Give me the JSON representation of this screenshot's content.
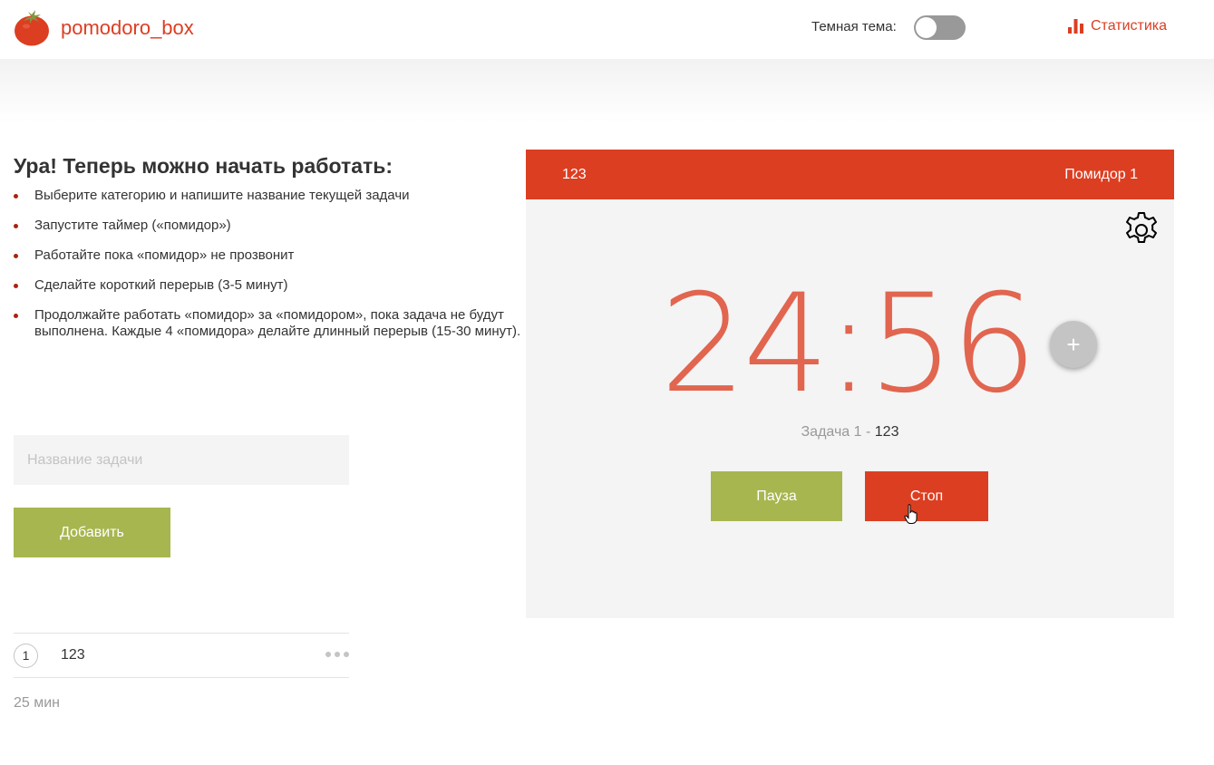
{
  "header": {
    "brand": "pomodoro_box",
    "theme_label": "Темная тема:",
    "dark_theme_enabled": false,
    "stats_label": "Статистика",
    "logo_icon": "tomato-logo-icon",
    "stats_icon": "bar-chart-icon"
  },
  "intro": {
    "title": "Ура! Теперь можно начать работать:",
    "steps": [
      "Выберите категорию и напишите название текущей задачи",
      "Запустите таймер («помидор»)",
      "Работайте пока «помидор» не прозвонит",
      "Сделайте короткий перерыв (3-5 минут)",
      "Продолжайте работать «помидор» за «помидором», пока задача не будут выполнена. Каждые 4 «помидора» делайте длинный перерыв (15-30 минут)."
    ]
  },
  "task_form": {
    "input_value": "",
    "input_placeholder": "Название задачи",
    "add_label": "Добавить"
  },
  "tasks": [
    {
      "count": "1",
      "name": "123"
    }
  ],
  "total_time": "25 мин",
  "timer": {
    "task_name": "123",
    "pomodoro_label": "Помидор 1",
    "time": "24:56",
    "caption_prefix": "Задача 1 - ",
    "caption_task": "123",
    "pause_label": "Пауза",
    "stop_label": "Стоп",
    "plus_label": "+",
    "settings_icon": "gear-icon"
  },
  "colors": {
    "accent_red": "#dc3e22",
    "accent_green": "#a8b64f",
    "panel_bg": "#f4f4f4",
    "muted": "#999999"
  }
}
